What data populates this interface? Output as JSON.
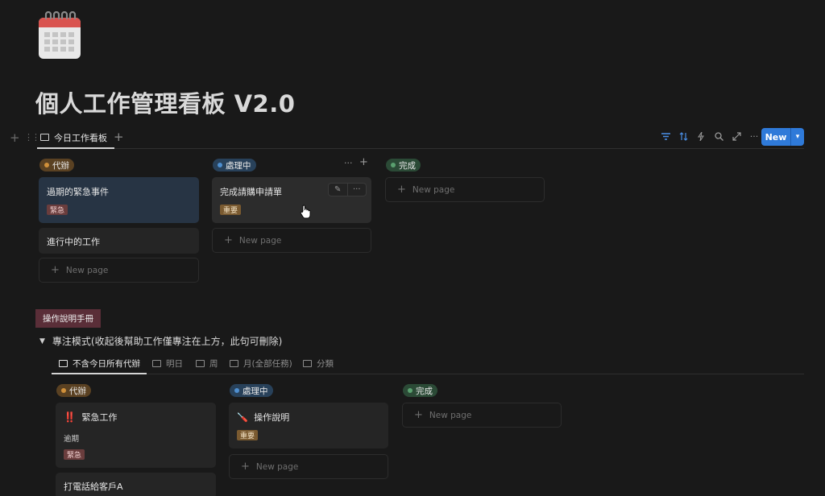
{
  "page": {
    "icon": "calendar-icon",
    "title": "個人工作管理看板 V2.0"
  },
  "toolbar": {
    "active_view": "今日工作看板",
    "right_icons": [
      "filter-icon",
      "sort-icon",
      "lightning-icon",
      "search-icon",
      "expand-icon",
      "more-icon"
    ],
    "new_label": "New"
  },
  "board1": {
    "columns": [
      {
        "name": "代辦",
        "cards": [
          {
            "title": "過期的緊急事件",
            "tag": "緊急"
          },
          {
            "title": "進行中的工作"
          }
        ],
        "new_page": "New page"
      },
      {
        "name": "處理中",
        "cards": [
          {
            "title": "完成請購申請單",
            "tag": "重要"
          }
        ],
        "new_page": "New page"
      },
      {
        "name": "完成",
        "cards": [],
        "new_page": "New page"
      }
    ]
  },
  "section2": {
    "manual_label": "操作說明手冊",
    "toggle_label": "專注模式(收起後幫助工作僅專注在上方，此句可刪除)",
    "views": [
      "不含今日所有代辦",
      "明日",
      "周",
      "月(全部任務)",
      "分類"
    ]
  },
  "board2": {
    "columns": [
      {
        "name": "代辦",
        "cards": [
          {
            "icon": "‼️",
            "title": "緊急工作",
            "sub": "逾期",
            "tag": "緊急"
          },
          {
            "title": "打電話給客戶A"
          }
        ]
      },
      {
        "name": "處理中",
        "cards": [
          {
            "icon": "🪛",
            "title": "操作說明",
            "tag": "重要"
          }
        ],
        "new_page": "New page"
      },
      {
        "name": "完成",
        "cards": [],
        "new_page": "New page"
      }
    ]
  },
  "colors": {
    "background": "#191919",
    "accent_blue": "#2f7ad9",
    "todo_dot": "#d0903a",
    "doing_dot": "#4f8fcf",
    "done_dot": "#5aa06f"
  }
}
